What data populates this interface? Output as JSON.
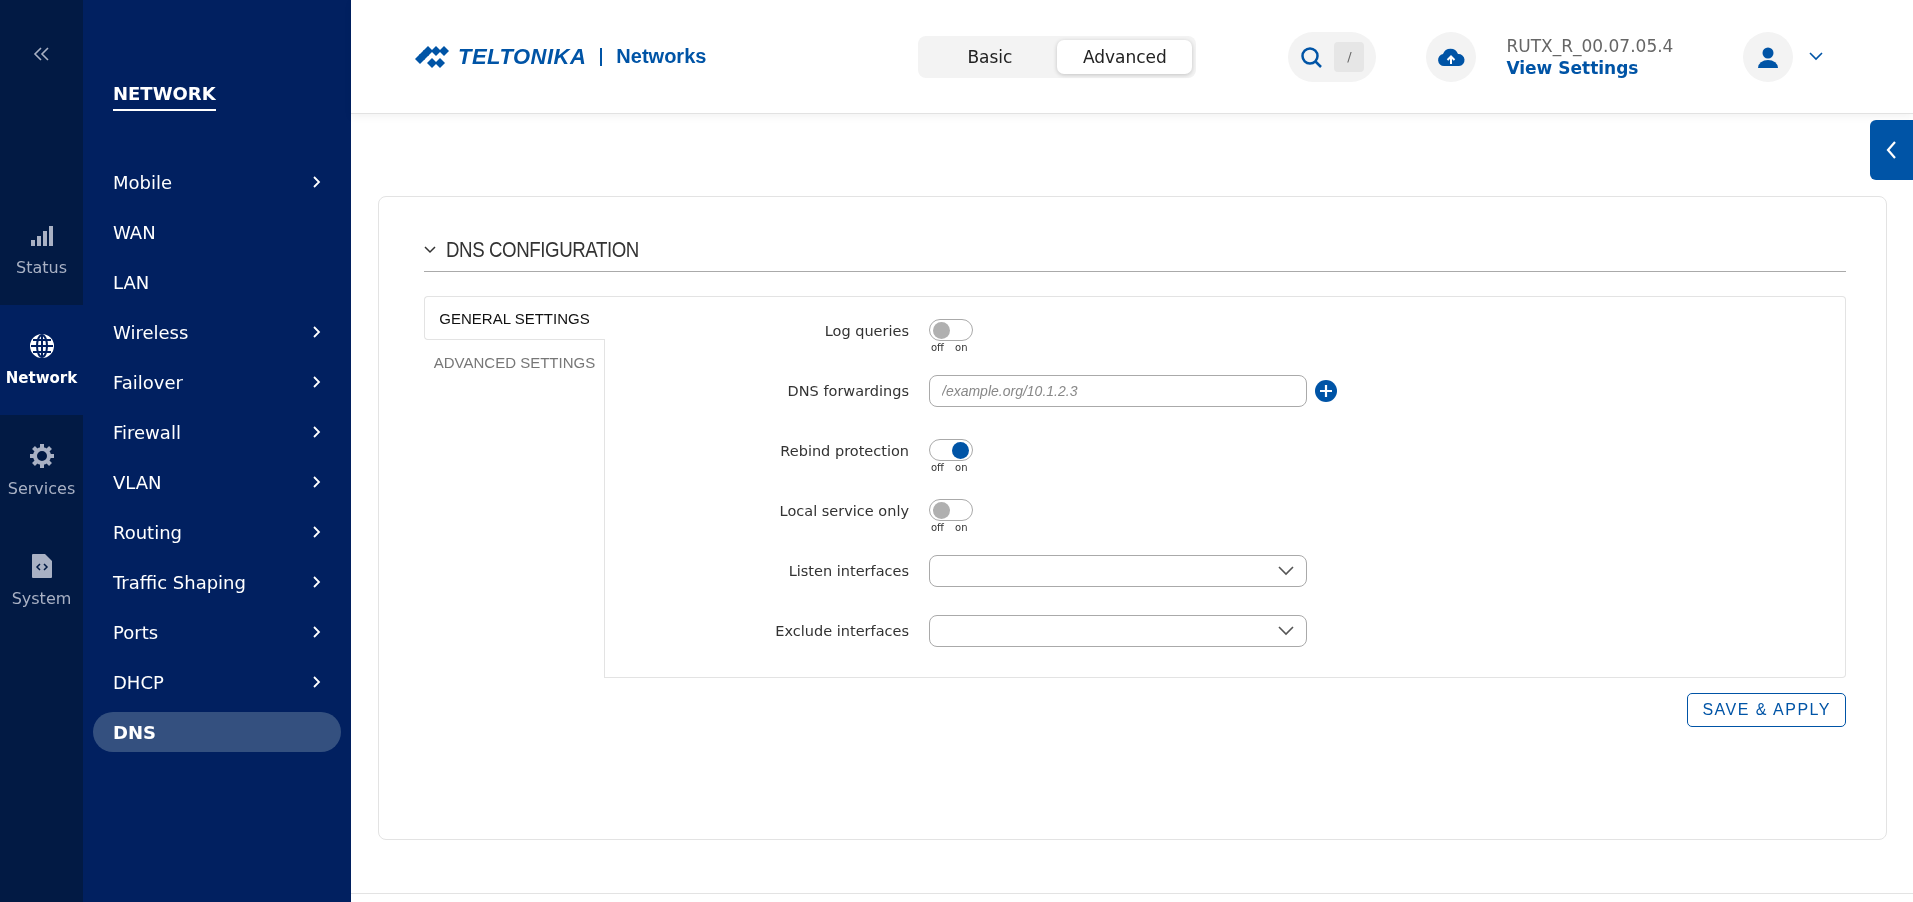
{
  "rail": {
    "items": [
      {
        "label": "Status",
        "kind": "signal",
        "selected": false
      },
      {
        "label": "Network",
        "kind": "globe",
        "selected": true
      },
      {
        "label": "Services",
        "kind": "gear",
        "selected": false
      },
      {
        "label": "System",
        "kind": "file",
        "selected": false
      }
    ]
  },
  "menu": {
    "title": "NETWORK",
    "items": [
      {
        "label": "Mobile",
        "has_submenu": true,
        "selected": false
      },
      {
        "label": "WAN",
        "has_submenu": false,
        "selected": false
      },
      {
        "label": "LAN",
        "has_submenu": false,
        "selected": false
      },
      {
        "label": "Wireless",
        "has_submenu": true,
        "selected": false
      },
      {
        "label": "Failover",
        "has_submenu": true,
        "selected": false
      },
      {
        "label": "Firewall",
        "has_submenu": true,
        "selected": false
      },
      {
        "label": "VLAN",
        "has_submenu": true,
        "selected": false
      },
      {
        "label": "Routing",
        "has_submenu": true,
        "selected": false
      },
      {
        "label": "Traffic Shaping",
        "has_submenu": true,
        "selected": false
      },
      {
        "label": "Ports",
        "has_submenu": true,
        "selected": false
      },
      {
        "label": "DHCP",
        "has_submenu": true,
        "selected": false
      },
      {
        "label": "DNS",
        "has_submenu": false,
        "selected": true
      }
    ]
  },
  "header": {
    "brand": "TELTONIKA",
    "brand_suffix": "Networks",
    "modes": [
      {
        "label": "Basic",
        "selected": false
      },
      {
        "label": "Advanced",
        "selected": true
      }
    ],
    "search_key": "/",
    "firmware": "RUTX_R_00.07.05.4",
    "firmware_link": "View Settings"
  },
  "section": {
    "title": "DNS CONFIGURATION",
    "expanded": true,
    "tabs": [
      {
        "label": "GENERAL SETTINGS",
        "selected": true
      },
      {
        "label": "ADVANCED SETTINGS",
        "selected": false
      }
    ],
    "fields": [
      {
        "kind": "toggle",
        "label": "Log queries",
        "on": false,
        "off_label": "off",
        "on_label": "on"
      },
      {
        "kind": "text",
        "label": "DNS forwardings",
        "placeholder": "/example.org/10.1.2.3",
        "addable": true
      },
      {
        "kind": "toggle",
        "label": "Rebind protection",
        "on": true,
        "off_label": "off",
        "on_label": "on"
      },
      {
        "kind": "toggle",
        "label": "Local service only",
        "on": false,
        "off_label": "off",
        "on_label": "on"
      },
      {
        "kind": "select",
        "label": "Listen interfaces"
      },
      {
        "kind": "select",
        "label": "Exclude interfaces"
      }
    ],
    "save_button": "SAVE & APPLY"
  }
}
